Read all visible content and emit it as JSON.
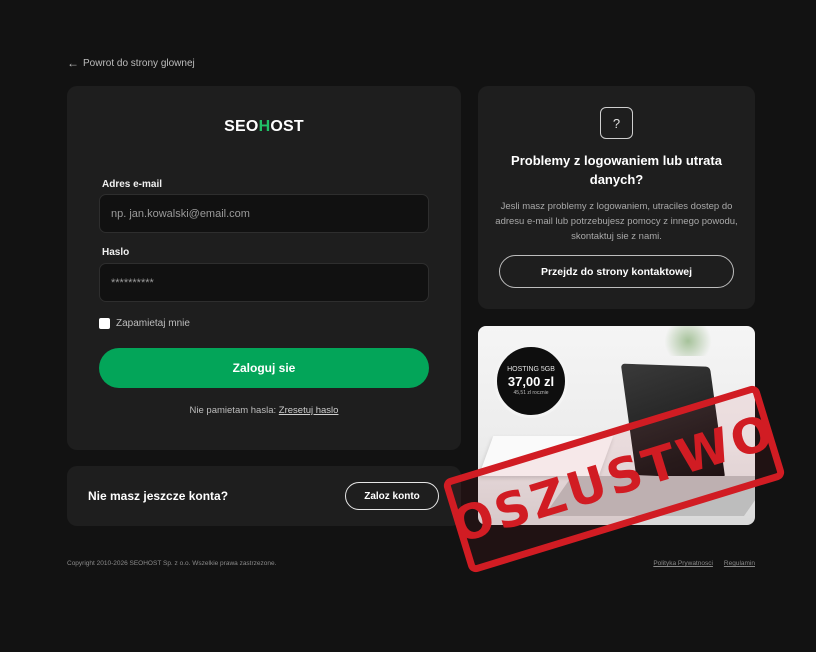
{
  "back_link": {
    "arrow": "←",
    "label": "Powrot do strony glownej"
  },
  "login": {
    "logo": {
      "left": "SEO",
      "accent": "H",
      "right": "OST"
    },
    "email_label": "Adres e-mail",
    "email_placeholder": "np. jan.kowalski@email.com",
    "password_label": "Haslo",
    "password_value": "**********",
    "remember_label": "Zapamietaj mnie",
    "submit_label": "Zaloguj sie",
    "forgot_text": "Nie pamietam hasla:",
    "reset_link": "Zresetuj haslo"
  },
  "register": {
    "prompt": "Nie masz jeszcze konta?",
    "button": "Zaloz konto"
  },
  "help": {
    "icon": "?",
    "title": "Problemy z logowaniem lub utrata danych?",
    "text": "Jesli masz problemy z logowaniem, utraciles dostep do adresu e-mail lub potrzebujesz pomocy z innego powodu, skontaktuj sie z nami.",
    "button": "Przejdz do strony kontaktowej"
  },
  "ad": {
    "badge_line1": "HOSTING 5GB",
    "badge_price": "37,00 zl",
    "badge_line3": "45,51 zl rocznie"
  },
  "stamp": {
    "text": "OSZUSTWO",
    "color": "#d11c23"
  },
  "footer": {
    "copyright": "Copyright 2010-2026 SEOHOST Sp. z o.o. Wszelkie prawa zastrzezone.",
    "privacy": "Polityka Prywatnosci",
    "terms": "Regulamin"
  },
  "colors": {
    "accent": "#03a559",
    "background": "#121212",
    "card": "#1e1e1e"
  }
}
